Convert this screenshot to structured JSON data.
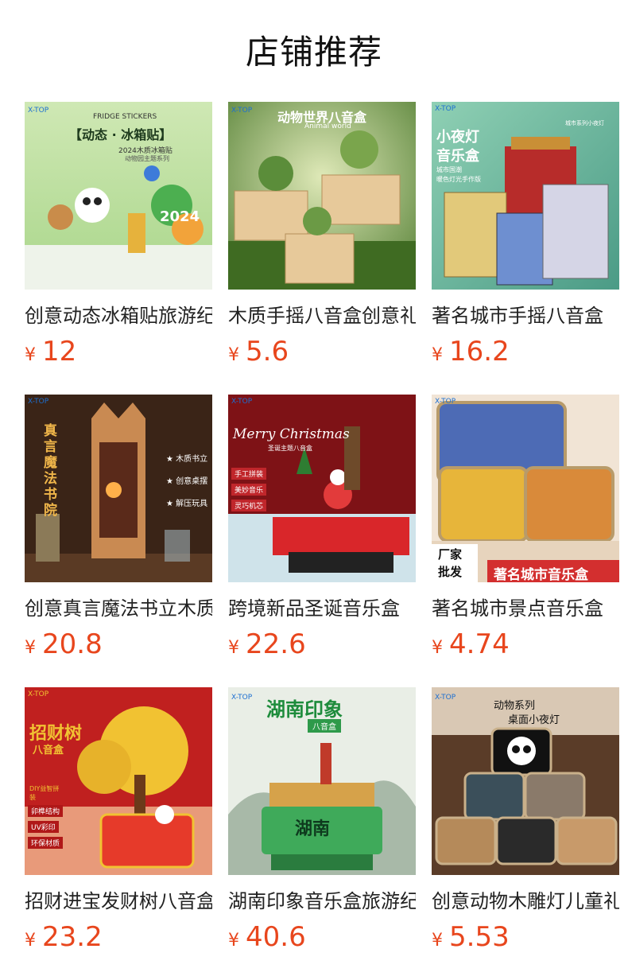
{
  "page": {
    "title": "店铺推荐"
  },
  "currency_symbol": "¥",
  "products": [
    {
      "name": "创意动态冰箱贴旅游纪念品",
      "price": "12",
      "badges": [
        "X-TOP",
        "FRIDGE STICKERS",
        "【动态 · 冰箱贴】",
        "2024木质冰箱贴",
        "动物园主题系列"
      ]
    },
    {
      "name": "木质手摇八音盒创意礼物",
      "price": "5.6",
      "badges": [
        "X-TOP",
        "动物世界八音盒",
        "Animal world"
      ]
    },
    {
      "name": "著名城市手摇八音盒",
      "price": "16.2",
      "badges": [
        "X-TOP",
        "小夜灯",
        "音乐盒",
        "城市系列小夜灯",
        "城市国潮",
        "暖色灯光手作版"
      ]
    },
    {
      "name": "创意真言魔法书立木质",
      "price": "20.8",
      "badges": [
        "X-TOP",
        "真言魔法书院",
        "★ 木质书立",
        "★ 创意桌摆",
        "★ 解压玩具"
      ]
    },
    {
      "name": "跨境新品圣诞音乐盒",
      "price": "22.6",
      "badges": [
        "X-TOP",
        "Merry Christmas",
        "圣诞主题八音盒",
        "手工拼装",
        "美妙音乐",
        "灵巧机芯"
      ]
    },
    {
      "name": "著名城市景点音乐盒",
      "price": "4.74",
      "badges": [
        "X-TOP",
        "厂家批发",
        "著名城市音乐盒"
      ]
    },
    {
      "name": "招财进宝发财树八音盒",
      "price": "23.2",
      "badges": [
        "X-TOP",
        "招财树",
        "八音盒",
        "DIY益智拼装",
        "卯榫结构",
        "UV彩印",
        "环保材质"
      ]
    },
    {
      "name": "湖南印象音乐盒旅游纪念",
      "price": "40.6",
      "badges": [
        "X-TOP",
        "湖南印象",
        "八音盒",
        "湖南"
      ]
    },
    {
      "name": "创意动物木雕灯儿童礼物",
      "price": "5.53",
      "badges": [
        "X-TOP",
        "动物系列",
        "桌面小夜灯"
      ]
    }
  ]
}
